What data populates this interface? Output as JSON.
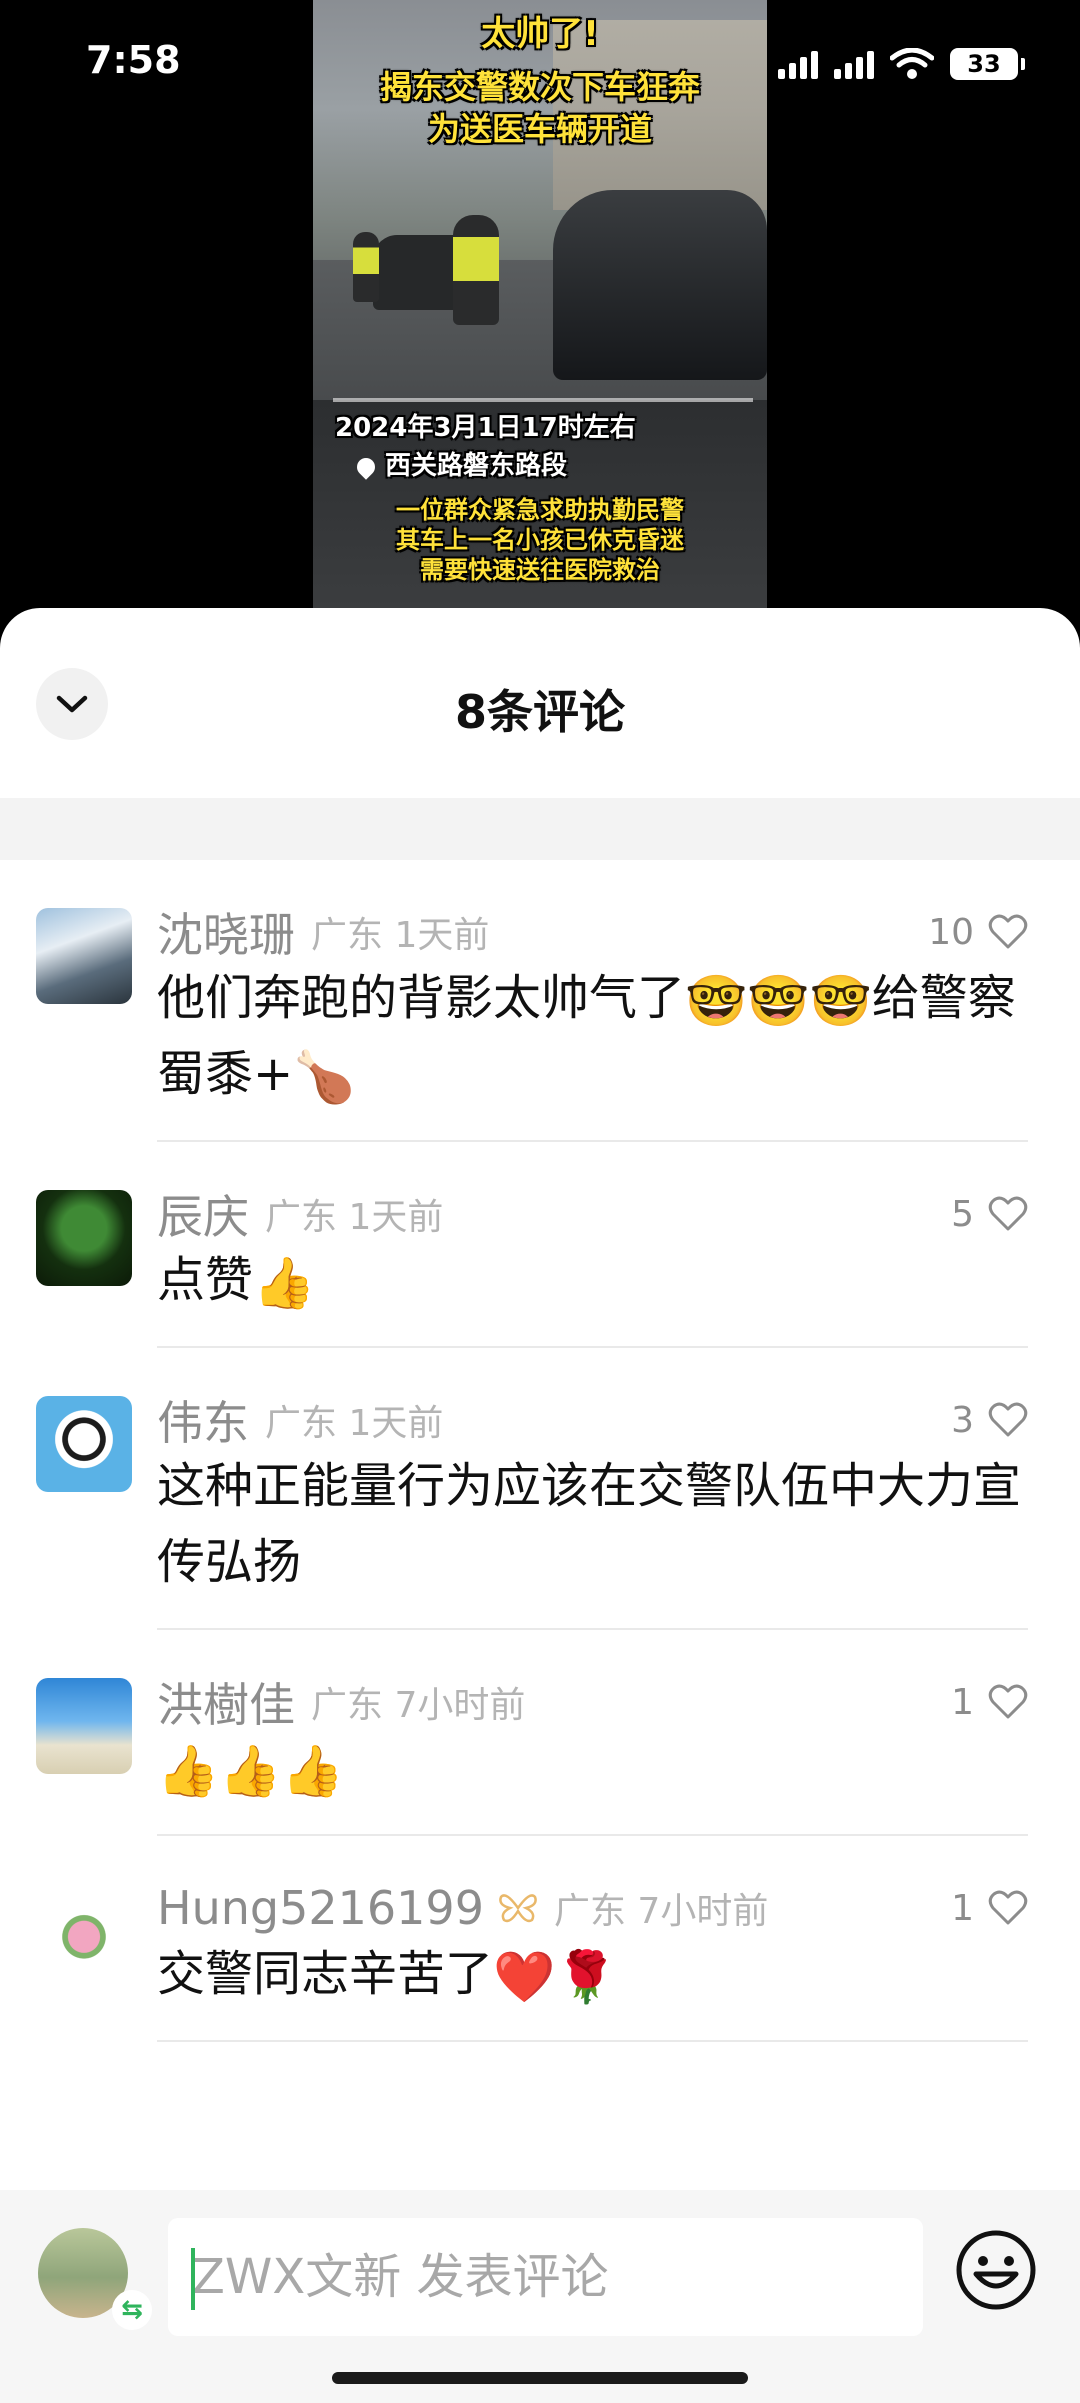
{
  "status_bar": {
    "time": "7:58",
    "battery": "33"
  },
  "video": {
    "overlay_title": "太帅了!",
    "headline_line1": "揭东交警数次下车狂奔",
    "headline_line2": "为送医车辆开道",
    "date_text": "2024年3月1日17时左右",
    "location_text": "西关路磐东路段",
    "desc_line1": "一位群众紧急求助执勤民警",
    "desc_line2": "其车上一名小孩已休克昏迷",
    "desc_line3": "需要快速送往医院救治"
  },
  "sheet": {
    "title": "8条评论"
  },
  "comments": [
    {
      "name": "沈晓珊",
      "meta": "广东 1天前",
      "likes": "10",
      "text": "他们奔跑的背影太帅气了",
      "emojis": "🤓🤓🤓",
      "text2": "给警察蜀黍+",
      "emoji2": "🍗"
    },
    {
      "name": "辰庆",
      "meta": "广东 1天前",
      "likes": "5",
      "text": "点赞",
      "emojis": "👍"
    },
    {
      "name": "伟东",
      "meta": "广东 1天前",
      "likes": "3",
      "text": "这种正能量行为应该在交警队伍中大力宣传弘扬"
    },
    {
      "name": "洪樹佳",
      "meta": "广东 7小时前",
      "likes": "1",
      "text": "",
      "emojis": "👍👍👍"
    },
    {
      "name": "Hung5216199",
      "meta": "广东 7小时前",
      "likes": "1",
      "text": "交警同志辛苦了",
      "emojis": "❤️🌹"
    }
  ],
  "input": {
    "placeholder": "ZWX文新 发表评论"
  },
  "icons": {
    "collapse": "chevron-down-icon",
    "like": "heart-outline-icon",
    "emoji": "smiley-icon",
    "badge": "butterfly-badge-icon"
  },
  "colors": {
    "accent": "#2fb45c",
    "meta_gray": "#8c8c8c"
  }
}
